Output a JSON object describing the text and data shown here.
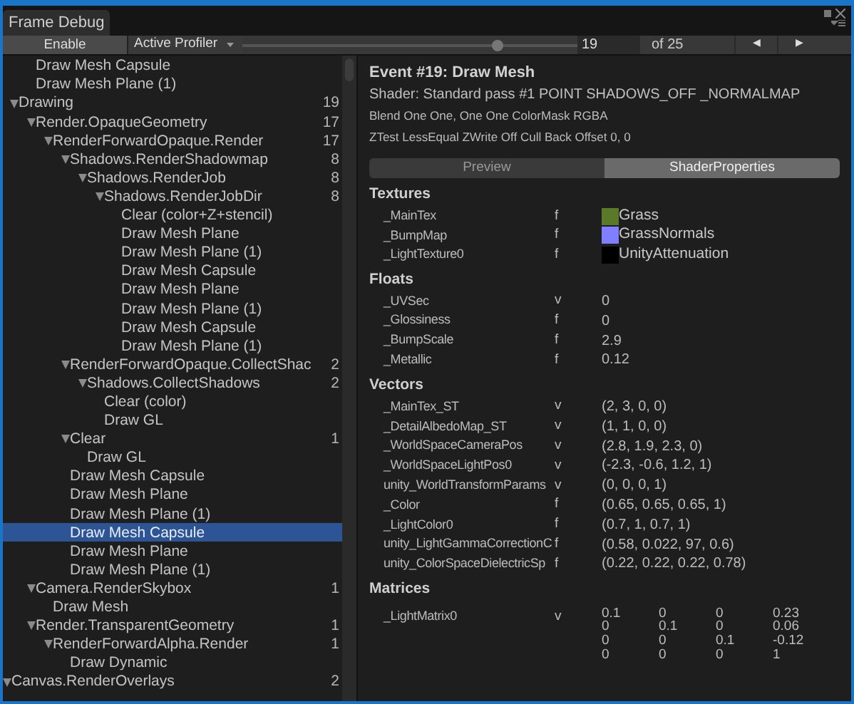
{
  "window": {
    "title": "Frame Debug"
  },
  "toolbar": {
    "enable_button": "Enable",
    "profiler_dropdown": "Active Profiler",
    "slider": {
      "level": 0.76
    },
    "event_field": "19",
    "event_total": "of 25",
    "prev_button": "◀",
    "next_button": "▶"
  },
  "tree": [
    {
      "children": [
        {
          "children": [
            {
              "label": "Draw Mesh Capsule",
              "selected": false
            },
            {
              "label": "Draw Mesh Plane (1)",
              "selected": false
            }
          ]
        },
        {
          "label": "Drawing",
          "count": "19",
          "expanded": true,
          "selected": false,
          "children": [
            {
              "label": "Render.OpaqueGeometry",
              "count": "17",
              "expanded": true,
              "selected": false,
              "children": [
                {
                  "label": "RenderForwardOpaque.Render",
                  "count": "17",
                  "expanded": true,
                  "selected": false,
                  "children": [
                    {
                      "label": "Shadows.RenderShadowmap",
                      "count": "8",
                      "expanded": true,
                      "selected": false,
                      "children": [
                        {
                          "label": "Shadows.RenderJob",
                          "count": "8",
                          "expanded": true,
                          "selected": false,
                          "children": [
                            {
                              "label": "Shadows.RenderJobDir",
                              "count": "8",
                              "expanded": true,
                              "selected": false,
                              "children": [
                                {
                                  "label": "Clear (color+Z+stencil)",
                                  "selected": false
                                },
                                {
                                  "label": "Draw Mesh Plane",
                                  "selected": false
                                },
                                {
                                  "label": "Draw Mesh Plane (1)",
                                  "selected": false
                                },
                                {
                                  "label": "Draw Mesh Capsule",
                                  "selected": false
                                },
                                {
                                  "label": "Draw Mesh Plane",
                                  "selected": false
                                },
                                {
                                  "label": "Draw Mesh Plane (1)",
                                  "selected": false
                                },
                                {
                                  "label": "Draw Mesh Capsule",
                                  "selected": false
                                },
                                {
                                  "label": "Draw Mesh Plane (1)",
                                  "selected": false
                                }
                              ]
                            }
                          ]
                        }
                      ]
                    },
                    {
                      "label": "RenderForwardOpaque.CollectShac",
                      "count": "2",
                      "expanded": true,
                      "selected": false,
                      "children": [
                        {
                          "label": "Shadows.CollectShadows",
                          "count": "2",
                          "expanded": true,
                          "selected": false,
                          "children": [
                            {
                              "label": "Clear (color)",
                              "selected": false
                            },
                            {
                              "label": "Draw GL",
                              "selected": false
                            }
                          ]
                        }
                      ]
                    },
                    {
                      "label": "Clear",
                      "count": "1",
                      "expanded": true,
                      "selected": false,
                      "children": [
                        {
                          "label": "Draw GL",
                          "selected": false
                        }
                      ]
                    },
                    {
                      "label": "Draw Mesh Capsule",
                      "selected": false
                    },
                    {
                      "label": "Draw Mesh Plane",
                      "selected": false
                    },
                    {
                      "label": "Draw Mesh Plane (1)",
                      "selected": false
                    },
                    {
                      "label": "Draw Mesh Capsule",
                      "selected": true
                    },
                    {
                      "label": "Draw Mesh Plane",
                      "selected": false
                    },
                    {
                      "label": "Draw Mesh Plane (1)",
                      "selected": false
                    }
                  ]
                }
              ]
            },
            {
              "label": "Camera.RenderSkybox",
              "count": "1",
              "expanded": true,
              "selected": false,
              "children": [
                {
                  "label": "Draw Mesh",
                  "selected": false
                }
              ]
            },
            {
              "label": "Render.TransparentGeometry",
              "count": "1",
              "expanded": true,
              "selected": false,
              "children": [
                {
                  "label": "RenderForwardAlpha.Render",
                  "count": "1",
                  "expanded": true,
                  "selected": false,
                  "children": [
                    {
                      "label": "Draw Dynamic",
                      "selected": false
                    }
                  ]
                }
              ]
            }
          ]
        }
      ]
    },
    {
      "label": "Canvas.RenderOverlays",
      "count": "2",
      "expanded": true,
      "selected": false
    }
  ],
  "event": {
    "title": "Event #19: Draw Mesh",
    "shader": "Shader: Standard pass #1  POINT SHADOWS_OFF _NORMALMAP",
    "blend": "Blend One One, One One ColorMask RGBA",
    "ztest": "ZTest LessEqual ZWrite Off Cull Back Offset 0, 0"
  },
  "tabs": [
    {
      "label": "Preview",
      "selected": false
    },
    {
      "label": "ShaderProperties",
      "selected": true
    }
  ],
  "sections": [
    {
      "title": "Textures",
      "rows": [
        {
          "kind": "texture",
          "name": "_MainTex",
          "type": "f",
          "value": "Grass",
          "color": "#5a7a2a"
        },
        {
          "kind": "texture",
          "name": "_BumpMap",
          "type": "f",
          "value": "GrassNormals",
          "color": "#7f7fff"
        },
        {
          "kind": "texture",
          "name": "_LightTexture0",
          "type": "f",
          "value": "UnityAttenuation",
          "color": "#000000"
        }
      ]
    },
    {
      "title": "Floats",
      "rows": [
        {
          "kind": "value",
          "name": "_UVSec",
          "type": "v",
          "value": "0"
        },
        {
          "kind": "value",
          "name": "_Glossiness",
          "type": "f",
          "value": "0"
        },
        {
          "kind": "value",
          "name": "_BumpScale",
          "type": "f",
          "value": "2.9"
        },
        {
          "kind": "value",
          "name": "_Metallic",
          "type": "f",
          "value": "0.12"
        }
      ]
    },
    {
      "title": "Vectors",
      "rows": [
        {
          "kind": "value",
          "name": "_MainTex_ST",
          "type": "v",
          "value": "(2, 3, 0, 0)"
        },
        {
          "kind": "value",
          "name": "_DetailAlbedoMap_ST",
          "type": "v",
          "value": "(1, 1, 0, 0)"
        },
        {
          "kind": "value",
          "name": "_WorldSpaceCameraPos",
          "type": "v",
          "value": "(2.8, 1.9, 2.3, 0)"
        },
        {
          "kind": "value",
          "name": "_WorldSpaceLightPos0",
          "type": "v",
          "value": "(-2.3, -0.6, 1.2, 1)"
        },
        {
          "kind": "value",
          "name": "unity_WorldTransformParams",
          "type": "v",
          "value": "(0, 0, 0, 1)"
        },
        {
          "kind": "value",
          "name": "_Color",
          "type": "f",
          "value": "(0.65, 0.65, 0.65, 1)"
        },
        {
          "kind": "value",
          "name": "_LightColor0",
          "type": "f",
          "value": "(0.7, 1, 0.7, 1)"
        },
        {
          "kind": "value",
          "name": "unity_LightGammaCorrectionC",
          "type": "f",
          "value": "(0.58, 0.022, 97, 0.6)"
        },
        {
          "kind": "value",
          "name": "unity_ColorSpaceDielectricSp",
          "type": "f",
          "value": "(0.22, 0.22, 0.22, 0.78)"
        }
      ]
    },
    {
      "title": "Matrices",
      "rows": [
        {
          "kind": "matrix",
          "name": "_LightMatrix0",
          "type": "v",
          "matrix": [
            [
              "0.1",
              "0",
              "0",
              "0.23"
            ],
            [
              "0",
              "0.1",
              "0",
              "0.06"
            ],
            [
              "0",
              "0",
              "0.1",
              "-0.12"
            ],
            [
              "0",
              "0",
              "0",
              "1"
            ]
          ]
        }
      ]
    }
  ]
}
